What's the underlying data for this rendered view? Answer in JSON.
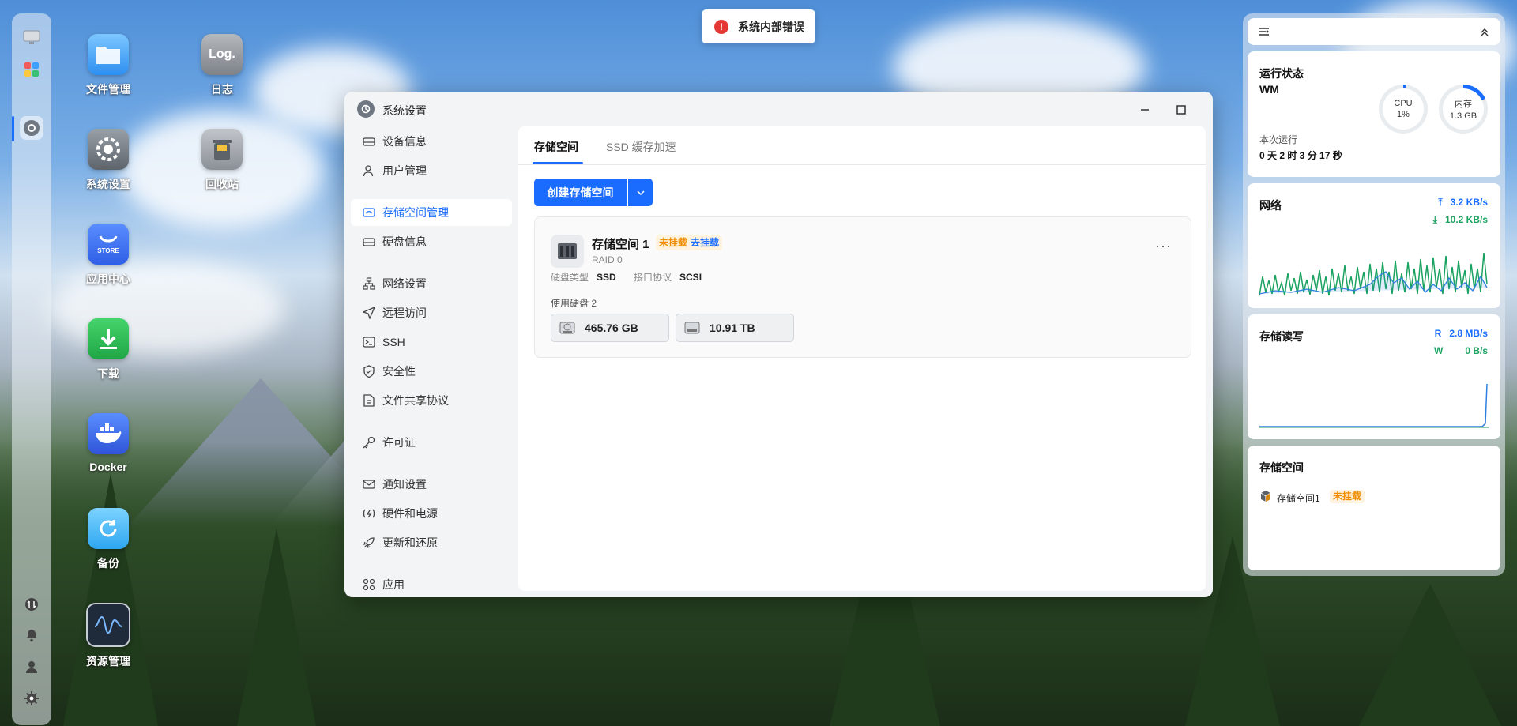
{
  "toast": {
    "message": "系统内部错误"
  },
  "desktop": {
    "icons": [
      {
        "label": "文件管理"
      },
      {
        "label": "日志",
        "glyph_text": "Log."
      },
      {
        "label": "系统设置"
      },
      {
        "label": "回收站"
      },
      {
        "label": "应用中心",
        "glyph_text": "STORE"
      },
      {
        "label": "下载"
      },
      {
        "label": "Docker"
      },
      {
        "label": "备份"
      },
      {
        "label": "资源管理"
      }
    ]
  },
  "window": {
    "title": "系统设置",
    "sidebar": [
      {
        "label": "设备信息",
        "icon": "drive-icon"
      },
      {
        "label": "用户管理",
        "icon": "user-icon"
      },
      {
        "label": "存储空间管理",
        "icon": "storage-icon"
      },
      {
        "label": "硬盘信息",
        "icon": "drive-icon"
      },
      {
        "label": "网络设置",
        "icon": "network-icon"
      },
      {
        "label": "远程访问",
        "icon": "send-icon"
      },
      {
        "label": "SSH",
        "icon": "terminal-icon"
      },
      {
        "label": "安全性",
        "icon": "shield-icon"
      },
      {
        "label": "文件共享协议",
        "icon": "document-icon"
      },
      {
        "label": "许可证",
        "icon": "key-icon"
      },
      {
        "label": "通知设置",
        "icon": "mail-icon"
      },
      {
        "label": "硬件和电源",
        "icon": "power-icon"
      },
      {
        "label": "更新和还原",
        "icon": "rocket-icon"
      },
      {
        "label": "应用",
        "icon": "apps-icon"
      }
    ],
    "active_item": "存储空间管理",
    "tabs": [
      {
        "label": "存储空间"
      },
      {
        "label": "SSD 缓存加速"
      }
    ],
    "create_button": "创建存储空间",
    "pool": {
      "name": "存储空间 1",
      "status": "未挂载",
      "mount_action": "去挂载",
      "raid": "RAID 0",
      "disk_type_label": "硬盘类型",
      "disk_type": "SSD",
      "interface_label": "接口协议",
      "interface": "SCSI",
      "disks_label": "使用硬盘 2",
      "disks": [
        {
          "size": "465.76 GB"
        },
        {
          "size": "10.91 TB"
        }
      ],
      "more": "···"
    }
  },
  "panel": {
    "status": {
      "title": "运行状态",
      "host": "WM",
      "cpu_label": "CPU",
      "cpu_value": "1%",
      "cpu_fraction": 0.01,
      "mem_label": "内存",
      "mem_value": "1.3 GB",
      "mem_fraction": 0.18,
      "uptime_label": "本次运行",
      "uptime_value": "0 天 2 时 3 分 17 秒"
    },
    "network": {
      "title": "网络",
      "up": "3.2 KB/s",
      "down": "10.2 KB/s"
    },
    "disk_io": {
      "title": "存储读写",
      "read_label": "R",
      "read": "2.8 MB/s",
      "write_label": "W",
      "write": "0 B/s"
    },
    "storage": {
      "title": "存储空间",
      "item_name": "存储空间1",
      "item_status": "未挂载"
    }
  },
  "colors": {
    "accent": "#1a6cff",
    "warning": "#f08c00",
    "error": "#e53935",
    "net_up": "#1a6cff",
    "net_down": "#1aa260"
  }
}
